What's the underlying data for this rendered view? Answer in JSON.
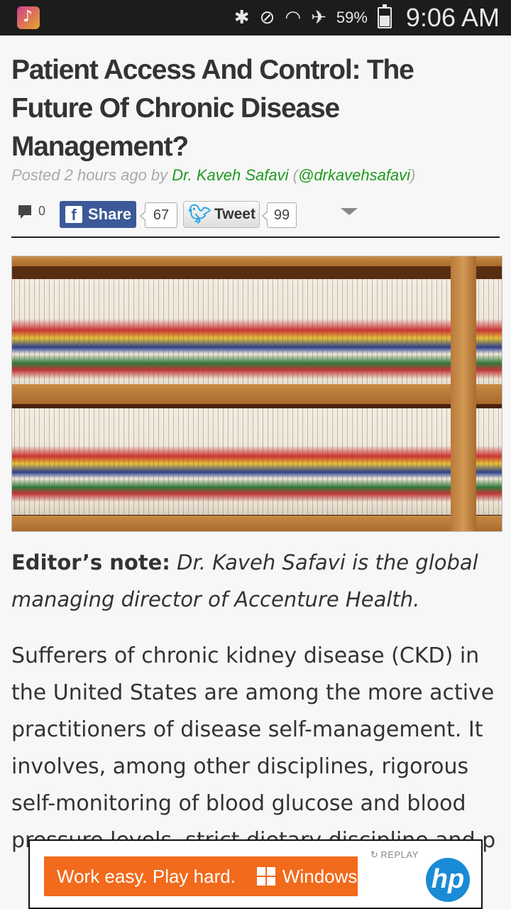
{
  "status_bar": {
    "battery_percent": "59%",
    "battery_level": 0.59,
    "time": "9:06 AM",
    "icons": [
      "music-app-icon",
      "bluetooth-icon",
      "mute-icon",
      "wifi-icon",
      "airplane-icon",
      "battery-icon"
    ]
  },
  "article": {
    "headline": "Patient Access And Control: The Future Of Chronic Disease Management?",
    "byline_prefix": "Posted 2 hours ago by ",
    "author": "Dr. Kaveh Safavi",
    "handle_open": " (",
    "handle": "@drkavehsafavi",
    "handle_close": ")"
  },
  "social": {
    "comment_count": "0",
    "share_label": "Share",
    "share_count": "67",
    "tweet_label": "Tweet",
    "tweet_count": "99"
  },
  "editor_note": {
    "label": "Editor’s note:",
    "text": " Dr. Kaveh Safavi is the global managing director of Accenture Health."
  },
  "body": {
    "paragraph": "Sufferers of chronic kidney disease (CKD) in the United States are among the more active practitioners of disease self-management. It involves, among other disciplines, rigorous self-monitoring of blood glucose and blood pressure levels, strict dietary discipline and p"
  },
  "ad": {
    "tagline": "Work easy. Play hard.",
    "brand": "Windows",
    "replay": "REPLAY",
    "logo": "hp"
  },
  "colors": {
    "author_green": "#1f9a1f",
    "facebook_blue": "#3b5998",
    "ad_orange": "#f26a1b",
    "hp_blue": "#1a8bd6"
  }
}
